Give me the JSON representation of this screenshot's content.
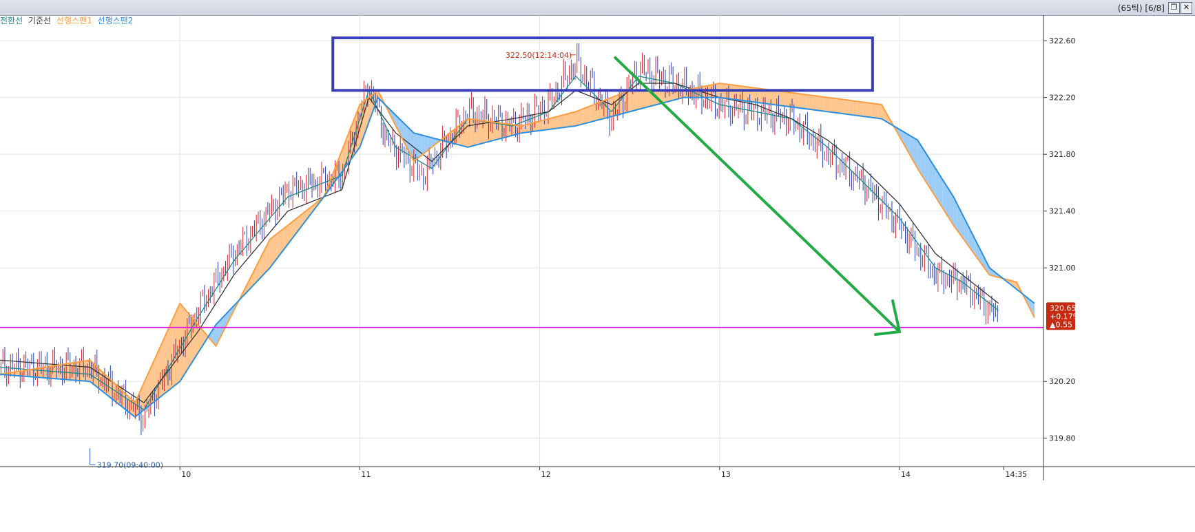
{
  "window": {
    "counter": "(65틱) [6/8]",
    "restore_icon": "restore-icon",
    "close_icon": "close-icon",
    "close_glyph": "✕"
  },
  "legend": {
    "items": [
      {
        "label": "전환선",
        "color": "#1a8a8a"
      },
      {
        "label": "기준선",
        "color": "#333333"
      },
      {
        "label": "선행스팬1",
        "color": "#ff9e40"
      },
      {
        "label": "선행스팬2",
        "color": "#2b8fe0"
      }
    ]
  },
  "chart_data": {
    "type": "candlestick",
    "title": "",
    "y_ticks": [
      "322.60",
      "322.20",
      "321.80",
      "321.40",
      "321.00",
      "320.20",
      "319.80"
    ],
    "y_tick_values": [
      322.6,
      322.2,
      321.8,
      321.4,
      321.0,
      320.2,
      319.8
    ],
    "ylim": [
      319.6,
      322.78
    ],
    "x_ticks": [
      "10",
      "11",
      "12",
      "13",
      "14",
      "14:35"
    ],
    "x_tick_values": [
      10,
      11,
      12,
      13,
      14,
      14.58
    ],
    "xlim": [
      9.0,
      14.8
    ],
    "grid": true,
    "price_line": {
      "x": [
        9.0,
        9.5,
        9.8,
        10.1,
        10.3,
        10.6,
        10.9,
        11.05,
        11.15,
        11.35,
        11.6,
        11.85,
        12.05,
        12.2,
        12.4,
        12.55,
        12.75,
        13.0,
        13.2,
        13.4,
        13.6,
        13.8,
        14.0,
        14.2,
        14.35,
        14.55
      ],
      "y": [
        320.3,
        320.3,
        319.95,
        320.7,
        321.1,
        321.55,
        321.65,
        322.3,
        321.9,
        321.65,
        322.1,
        322.0,
        322.15,
        322.45,
        322.05,
        322.4,
        322.3,
        322.15,
        322.1,
        322.05,
        321.8,
        321.6,
        321.3,
        320.95,
        320.9,
        320.65
      ]
    },
    "series": [
      {
        "name": "전환선",
        "color": "#1a8a8a",
        "x": [
          9.0,
          9.5,
          9.8,
          10.1,
          10.3,
          10.6,
          10.9,
          11.05,
          11.2,
          11.4,
          11.6,
          11.85,
          12.05,
          12.2,
          12.4,
          12.55,
          12.75,
          13.0,
          13.2,
          13.4,
          13.6,
          13.8,
          14.0,
          14.2,
          14.35,
          14.55
        ],
        "y": [
          320.3,
          320.25,
          320.0,
          320.65,
          321.05,
          321.5,
          321.65,
          322.25,
          321.85,
          321.7,
          322.05,
          322.0,
          322.1,
          322.35,
          322.1,
          322.35,
          322.3,
          322.15,
          322.1,
          322.05,
          321.85,
          321.6,
          321.35,
          321.0,
          320.9,
          320.7
        ]
      },
      {
        "name": "기준선",
        "color": "#333333",
        "x": [
          9.0,
          9.5,
          9.8,
          10.1,
          10.3,
          10.6,
          10.9,
          11.05,
          11.2,
          11.4,
          11.6,
          11.85,
          12.05,
          12.2,
          12.4,
          12.55,
          12.75,
          13.0,
          13.2,
          13.4,
          13.6,
          13.8,
          14.0,
          14.2,
          14.35,
          14.55
        ],
        "y": [
          320.35,
          320.3,
          320.05,
          320.55,
          320.95,
          321.4,
          321.55,
          322.2,
          321.95,
          321.75,
          322.0,
          322.05,
          322.1,
          322.25,
          322.15,
          322.3,
          322.3,
          322.2,
          322.15,
          322.05,
          321.9,
          321.7,
          321.45,
          321.1,
          320.95,
          320.75
        ]
      },
      {
        "name": "선행스팬1",
        "color": "#ff9e40",
        "x": [
          9.0,
          9.5,
          9.75,
          10.0,
          10.2,
          10.5,
          10.8,
          11.0,
          11.1,
          11.3,
          11.6,
          11.9,
          12.2,
          12.5,
          12.8,
          13.0,
          13.3,
          13.6,
          13.9,
          14.1,
          14.3,
          14.5,
          14.65,
          14.75
        ],
        "y": [
          320.25,
          320.35,
          320.05,
          320.75,
          320.45,
          321.2,
          321.5,
          322.15,
          322.25,
          321.75,
          322.05,
          322.0,
          322.1,
          322.25,
          322.25,
          322.3,
          322.25,
          322.2,
          322.15,
          321.7,
          321.3,
          320.95,
          320.9,
          320.65
        ]
      },
      {
        "name": "선행스팬2",
        "color": "#2b8fe0",
        "x": [
          9.0,
          9.5,
          9.75,
          10.0,
          10.2,
          10.5,
          10.8,
          11.0,
          11.1,
          11.3,
          11.6,
          11.9,
          12.2,
          12.5,
          12.8,
          13.0,
          13.3,
          13.6,
          13.9,
          14.1,
          14.3,
          14.5,
          14.65,
          14.75
        ],
        "y": [
          320.25,
          320.2,
          319.95,
          320.2,
          320.6,
          321.0,
          321.5,
          321.85,
          322.2,
          321.95,
          321.85,
          321.95,
          322.0,
          322.1,
          322.2,
          322.2,
          322.15,
          322.1,
          322.05,
          321.9,
          321.5,
          321.0,
          320.85,
          320.75
        ]
      }
    ],
    "annotations": {
      "high_label": "322.50(12:14:04)",
      "high_value": 322.5,
      "high_x": 12.2,
      "low_label": "319.70(09:40:00)",
      "low_value": 319.7,
      "low_x": 9.5
    },
    "current_price": {
      "price": "320.65",
      "change_pct": "+0.17%",
      "change": "▲0.55",
      "value": 320.65,
      "color": "#c62a10"
    },
    "horizontal_line": {
      "value": 320.58,
      "color": "#e020e0"
    },
    "highlight_box": {
      "x1": 10.85,
      "x2": 13.85,
      "y1": 322.25,
      "y2": 322.62,
      "color": "#3a3fb8"
    },
    "trend_arrow": {
      "x1": 12.42,
      "y1": 322.48,
      "x2": 14.0,
      "y2": 320.55,
      "color": "#22aa44"
    }
  }
}
